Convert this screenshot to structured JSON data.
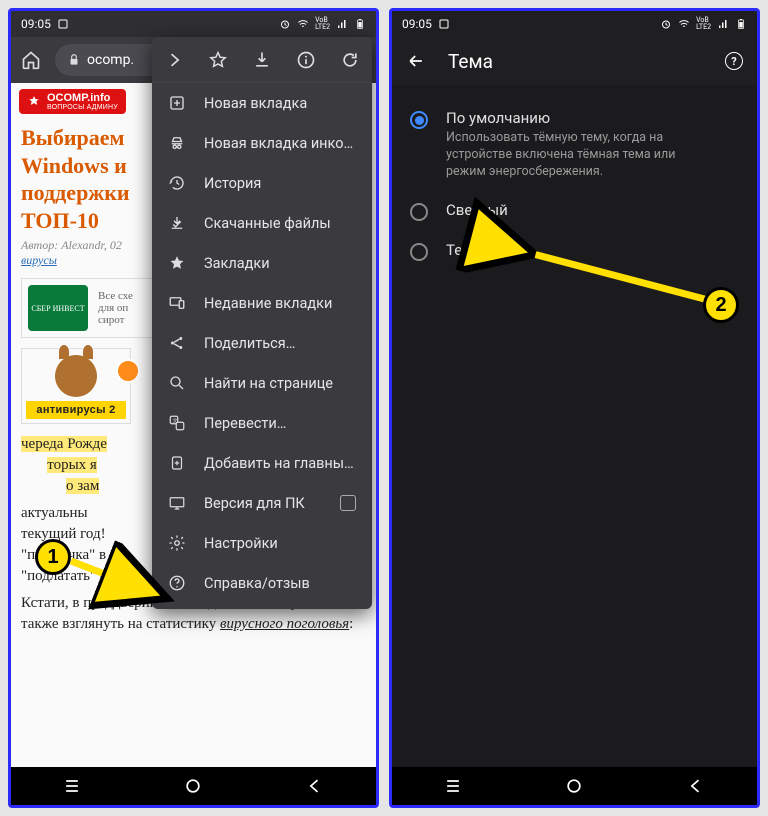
{
  "status": {
    "time": "09:05"
  },
  "chrome": {
    "url_host": "ocomp."
  },
  "logo": {
    "name": "OCOMP.info",
    "tagline": "ВОПРОСЫ АДМИНУ"
  },
  "article": {
    "title_l1": "Выбираем",
    "title_l2": "Windows и",
    "title_l3": "поддержки",
    "title_l4": "ТОП-10",
    "by_prefix": "Автор: Alexandr, 02",
    "tag": "вирусы",
    "ad_text": "Все схе\nдля оп\nсирот",
    "ad_badge": "СБЕР ИНВЕСТ",
    "av_banner": "антивирусы 2",
    "para1a": "череда Рожде",
    "para1b": "торых я",
    "para1c": "о зам",
    "para2a": "актуальны",
    "para2b": "текущий год!",
    "para2c": "\"привычка\" в",
    "para2d": "\"подлатать\" с",
    "para3": "Кстати, в преддверии нового десятилетия решил также взглянуть на статистику ",
    "para3_link": "вирусного поголовья"
  },
  "menu": {
    "items": [
      "Новая вкладка",
      "Новая вкладка инко…",
      "История",
      "Скачанные файлы",
      "Закладки",
      "Недавние вкладки",
      "Поделиться…",
      "Найти на странице",
      "Перевести…",
      "Добавить на главны…",
      "Версия для ПК",
      "Настройки",
      "Справка/отзыв"
    ]
  },
  "settings": {
    "title": "Тема",
    "options": [
      {
        "title": "По умолчанию",
        "desc": "Использовать тёмную тему, когда на устройстве включена тёмная тема или режим энергосбережения."
      },
      {
        "title": "Светлый"
      },
      {
        "title": "Темный"
      }
    ]
  },
  "badges": {
    "one": "1",
    "two": "2"
  }
}
